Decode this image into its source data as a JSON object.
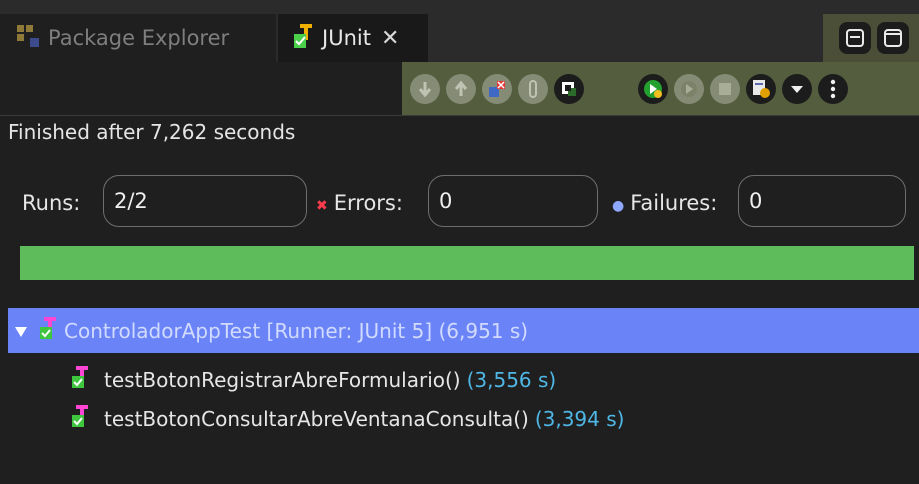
{
  "tabs": [
    {
      "label": "Package Explorer",
      "icon": "package-explorer-icon",
      "active": false
    },
    {
      "label": "JUnit",
      "icon": "junit-icon",
      "active": true
    }
  ],
  "status_text": "Finished after 7,262 seconds",
  "counters": {
    "runs_label": "Runs:",
    "runs_value": "2/2",
    "errors_label": "Errors:",
    "errors_value": "0",
    "failures_label": "Failures:",
    "failures_value": "0"
  },
  "progress": {
    "fraction": 1.0,
    "color": "#5ebc5a"
  },
  "tree": {
    "root": {
      "name": "ControladorAppTest [Runner: JUnit 5] (6,951 s)"
    },
    "children": [
      {
        "name": "testBotonRegistrarAbreFormulario()",
        "duration": "(3,556 s)"
      },
      {
        "name": "testBotonConsultarAbreVentanaConsulta()",
        "duration": "(3,394 s)"
      }
    ]
  },
  "colors": {
    "accent_selection": "#6a84f7",
    "success": "#5ebc5a",
    "duration": "#4fb7e6"
  }
}
